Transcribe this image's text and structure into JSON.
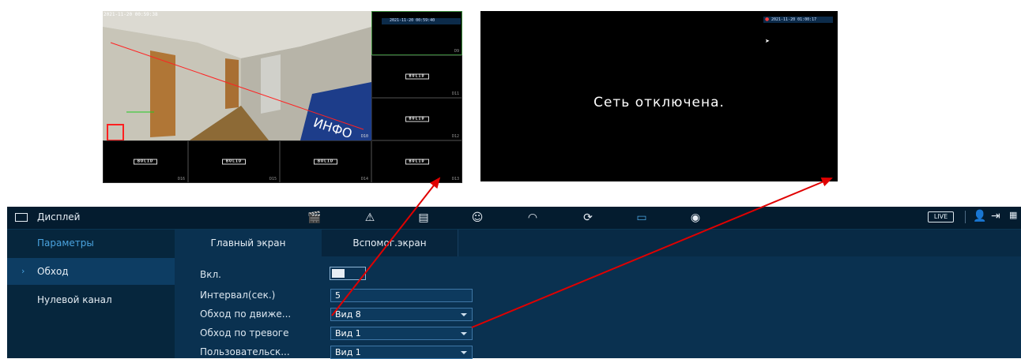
{
  "multiview": {
    "main_timestamp": "2021-11-20 00:59:38",
    "side_timestamp": "2021-11-20 00:59:40",
    "main_channel": "D10",
    "logo_text": "BOLID",
    "channels": [
      "D9",
      "D11",
      "D12",
      "D16",
      "D15",
      "D14",
      "D13"
    ]
  },
  "network_screen": {
    "timestamp": "2021-11-20 01:00:17",
    "message": "Сеть отключена."
  },
  "window": {
    "title": "Дисплей",
    "live_label": "LIVE"
  },
  "toolbar_icons": [
    "camera-icon",
    "alarm-icon",
    "storage-icon",
    "ai-icon",
    "speed-icon",
    "network-icon",
    "display-icon",
    "monitor-icon",
    "audio-icon"
  ],
  "sidebar": {
    "items": [
      {
        "label": "Параметры",
        "active": false
      },
      {
        "label": "Обход",
        "active": true
      },
      {
        "label": "Нулевой канал",
        "active": false
      }
    ]
  },
  "tabs": [
    {
      "label": "Главный экран",
      "active": true
    },
    {
      "label": "Вспомог.экран",
      "active": false
    }
  ],
  "form": {
    "enable_label": "Вкл.",
    "interval_label": "Интервал(сек.)",
    "interval_value": "5",
    "motion_label": "Обход по движе...",
    "motion_value": "Вид 8",
    "alarm_label": "Обход по тревоге",
    "alarm_value": "Вид 1",
    "custom_label": "Пользовательск...",
    "custom_value": "Вид 1"
  },
  "colors": {
    "annotation_arrow": "#e00000",
    "accent": "#4aa3df"
  }
}
